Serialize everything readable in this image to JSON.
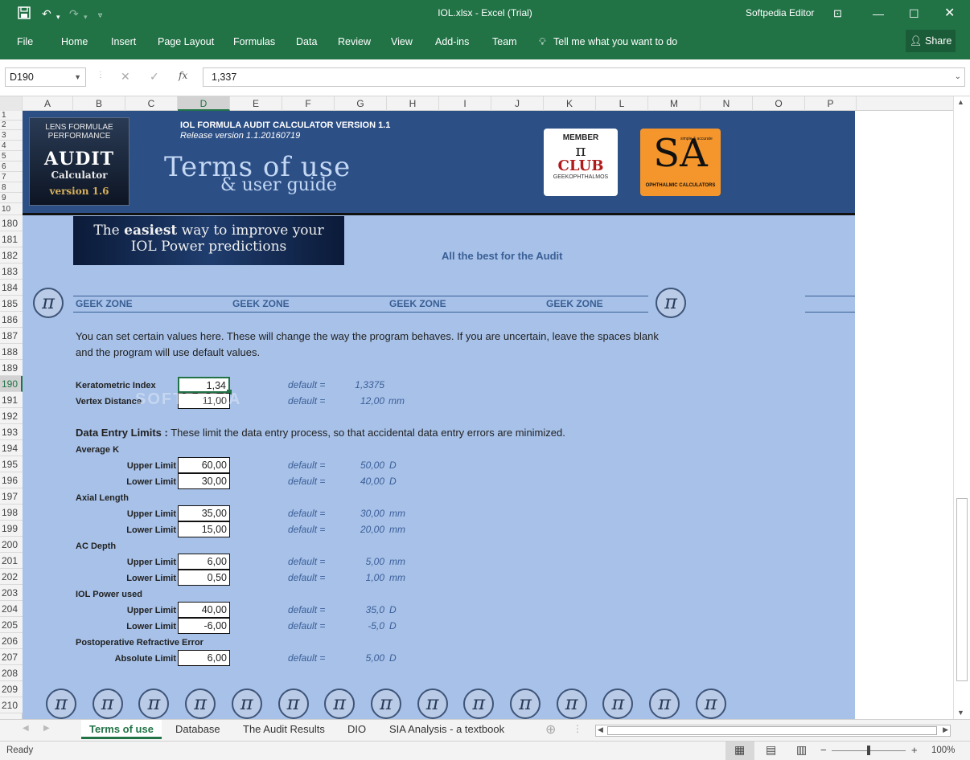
{
  "titlebar": {
    "title": "IOL.xlsx - Excel (Trial)",
    "user": "Softpedia Editor"
  },
  "menu": {
    "items": [
      "File",
      "Home",
      "Insert",
      "Page Layout",
      "Formulas",
      "Data",
      "Review",
      "View",
      "Add-ins",
      "Team"
    ],
    "tell": "Tell me what you want to do",
    "share": "Share"
  },
  "formula": {
    "namebox": "D190",
    "value": "1,337",
    "fx": "fx"
  },
  "columns": [
    "A",
    "B",
    "C",
    "D",
    "E",
    "F",
    "G",
    "H",
    "I",
    "J",
    "K",
    "L",
    "M",
    "N",
    "O",
    "P"
  ],
  "banner_rows": [
    "1",
    "2",
    "3",
    "4",
    "5",
    "6",
    "7",
    "8",
    "9",
    "10"
  ],
  "rows": [
    "180",
    "181",
    "182",
    "183",
    "184",
    "185",
    "186",
    "187",
    "188",
    "189",
    "190",
    "191",
    "192",
    "193",
    "194",
    "195",
    "196",
    "197",
    "198",
    "199",
    "200",
    "201",
    "202",
    "203",
    "204",
    "205",
    "206",
    "207",
    "208",
    "209",
    "210"
  ],
  "banner": {
    "logo_line1": "LENS FORMULAE",
    "logo_line2": "PERFORMANCE",
    "logo_big": "AUDIT",
    "logo_sub": "Calculator",
    "logo_version": "version 1.6",
    "title": "IOL FORMULA AUDIT CALCULATOR VERSION 1.1",
    "release": "Release version 1.1.20160719",
    "terms": "Terms of use",
    "guide": "& user guide",
    "club_member": "MEMBER",
    "club_pi": "π",
    "club_name": "CLUB",
    "club_sub": "GEEKOPHTHALMOS",
    "sa_letters": "SA",
    "sa_tag": "simple & accurate",
    "sa_sub": "OPHTHALMIC CALCULATORS"
  },
  "promo": {
    "line1_pre": "The ",
    "line1_bold": "easiest",
    "line1_post": " way to improve your",
    "line2": "IOL Power predictions"
  },
  "best": "All the best for the Audit",
  "geek": [
    "GEEK ZONE",
    "GEEK ZONE",
    "GEEK ZONE",
    "GEEK ZONE"
  ],
  "pi": "π",
  "intro1": "You can set certain values here. These will change the way the program behaves. If you are uncertain, leave the spaces blank",
  "intro2": "and the program will use default values.",
  "ker": {
    "label": "Keratometric Index",
    "value": "1,34",
    "default_label": "default =",
    "default": "1,3375",
    "unit": ""
  },
  "vertex": {
    "label": "Vertex Distance",
    "value": "11,00",
    "default_label": "default =",
    "default": "12,00",
    "unit": "mm"
  },
  "limits_title": "Data Entry Limits :",
  "limits_desc": " These limit the data entry process, so that accidental data entry errors are minimized.",
  "avgk": {
    "title": "Average K",
    "upper": {
      "label": "Upper Limit",
      "value": "60,00",
      "default": "50,00",
      "unit": "D"
    },
    "lower": {
      "label": "Lower Limit",
      "value": "30,00",
      "default": "40,00",
      "unit": "D"
    }
  },
  "axial": {
    "title": "Axial Length",
    "upper": {
      "label": "Upper Limit",
      "value": "35,00",
      "default": "30,00",
      "unit": "mm"
    },
    "lower": {
      "label": "Lower Limit",
      "value": "15,00",
      "default": "20,00",
      "unit": "mm"
    }
  },
  "acd": {
    "title": "AC Depth",
    "upper": {
      "label": "Upper Limit",
      "value": "6,00",
      "default": "5,00",
      "unit": "mm"
    },
    "lower": {
      "label": "Lower Limit",
      "value": "0,50",
      "default": "1,00",
      "unit": "mm"
    }
  },
  "iol": {
    "title": "IOL Power used",
    "upper": {
      "label": "Upper Limit",
      "value": "40,00",
      "default": "35,0",
      "unit": "D"
    },
    "lower": {
      "label": "Lower Limit",
      "value": "-6,00",
      "default": "-5,0",
      "unit": "D"
    }
  },
  "postop": {
    "title": "Postoperative Refractive Error",
    "abs": {
      "label": "Absolute Limit",
      "value": "6,00",
      "default": "5,00",
      "unit": "D"
    }
  },
  "default_label": "default =",
  "tabs": [
    "Terms of use",
    "Database",
    "The Audit Results",
    "DIO",
    "SIA Analysis - a textbook"
  ],
  "status": {
    "ready": "Ready",
    "zoom": "100%"
  },
  "watermark": "SOFTPEDIA"
}
